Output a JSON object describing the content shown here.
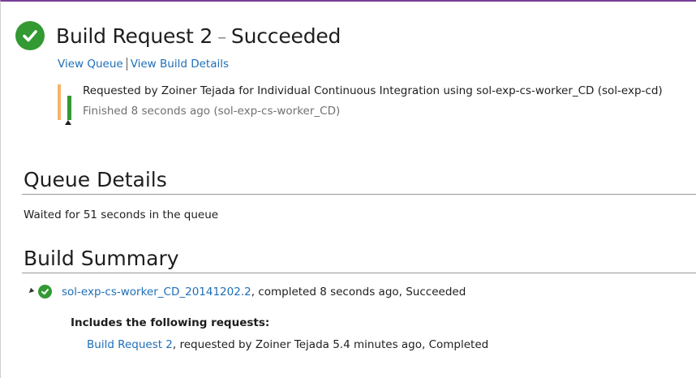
{
  "header": {
    "title": "Build Request 2",
    "dash": "–",
    "status": "Succeeded"
  },
  "links": {
    "view_queue": "View Queue",
    "view_build_details": "View Build Details"
  },
  "request": {
    "description": "Requested by Zoiner Tejada for Individual Continuous Integration using sol-exp-cs-worker_CD (sol-exp-cd)",
    "finished": "Finished 8 seconds ago (sol-exp-cs-worker_CD)"
  },
  "queue_details": {
    "title": "Queue Details",
    "text": "Waited for 51 seconds in the queue"
  },
  "build_summary": {
    "title": "Build Summary",
    "build_link": "sol-exp-cs-worker_CD_20141202.2",
    "build_suffix": ", completed 8 seconds ago, Succeeded",
    "includes_label": "Includes the following requests:",
    "request_link": "Build Request 2",
    "request_suffix": ", requested by Zoiner Tejada 5.4 minutes ago, Completed"
  },
  "colors": {
    "success_green": "#339933",
    "link_blue": "#1e6fb8",
    "accent_purple": "#7a3f98",
    "bar_orange": "#f7b36a"
  },
  "icons": {
    "status": "success-check-icon",
    "expander": "collapse-triangle-icon"
  }
}
